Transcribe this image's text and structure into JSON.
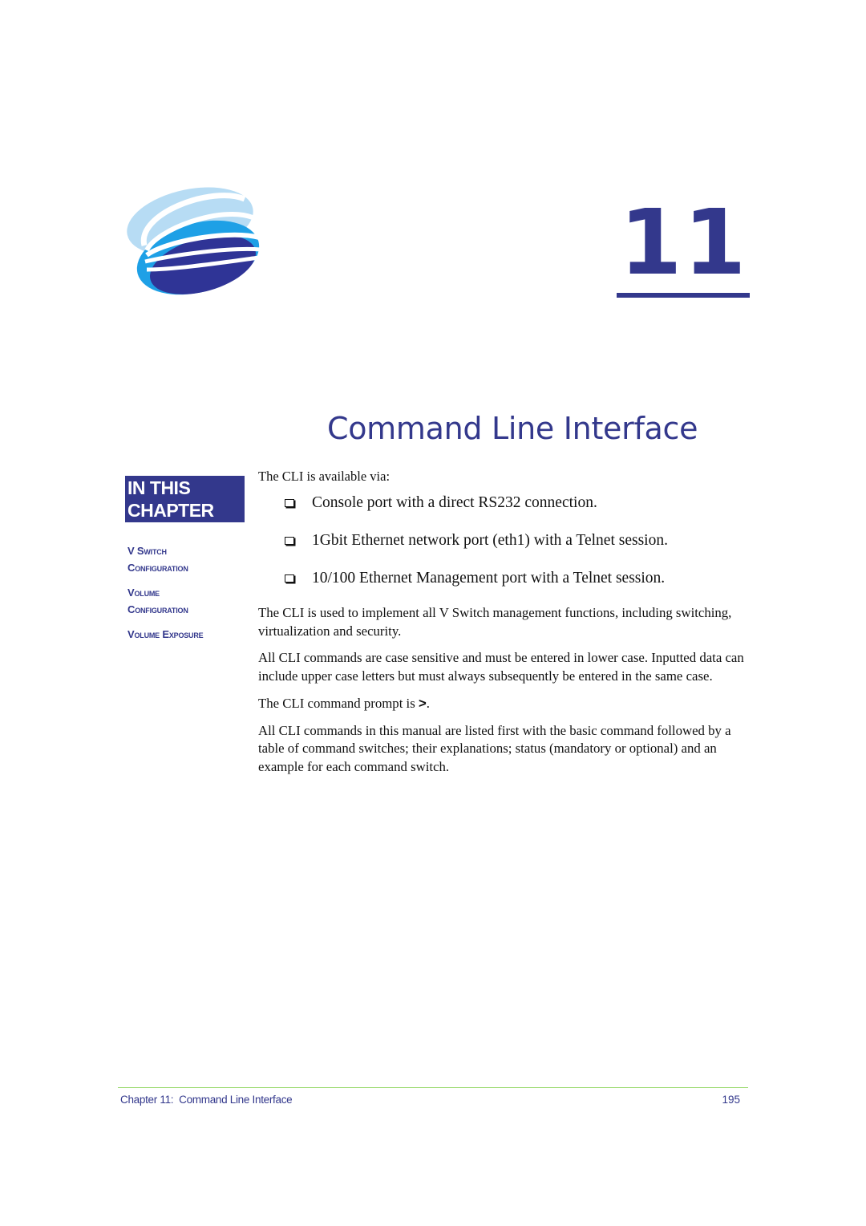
{
  "chapter": {
    "number": "11",
    "title": "Command Line Interface"
  },
  "sidebar": {
    "box_line1": "IN THIS",
    "box_line2": "CHAPTER",
    "links": [
      {
        "line1": "V Switch",
        "line2": "Configuration"
      },
      {
        "line1": "Volume",
        "line2": "Configuration"
      },
      {
        "line1": "Volume Exposure",
        "line2": ""
      }
    ]
  },
  "body": {
    "intro": "The CLI is available via:",
    "bullets": [
      "Console port with a direct RS232 connection.",
      "1Gbit Ethernet network port (eth1) with a Telnet session.",
      "10/100 Ethernet Management port with a Telnet session."
    ],
    "paragraphs": [
      "The CLI is used to implement all V Switch management functions, including switching, virtualization and security.",
      "All CLI commands are case sensitive and must be entered in lower case. Inputted data can include upper case letters but must always subsequently be entered in the same case."
    ],
    "prompt_prefix": "The CLI command prompt is ",
    "prompt_symbol": ">",
    "prompt_suffix": ".",
    "last_paragraph": "All CLI commands in this manual are listed first with the basic command followed by a table of command switches;  their explanations; status (mandatory or optional) and an example for each command switch."
  },
  "footer": {
    "chapter_label": "Chapter 11:  Command Line Interface",
    "page_number": "195"
  },
  "colors": {
    "brand_navy": "#33388c",
    "logo_light": "#b7dcf4",
    "logo_mid": "#1ea0e6",
    "logo_dark": "#2f3496",
    "footer_rule": "#9cdb72"
  }
}
